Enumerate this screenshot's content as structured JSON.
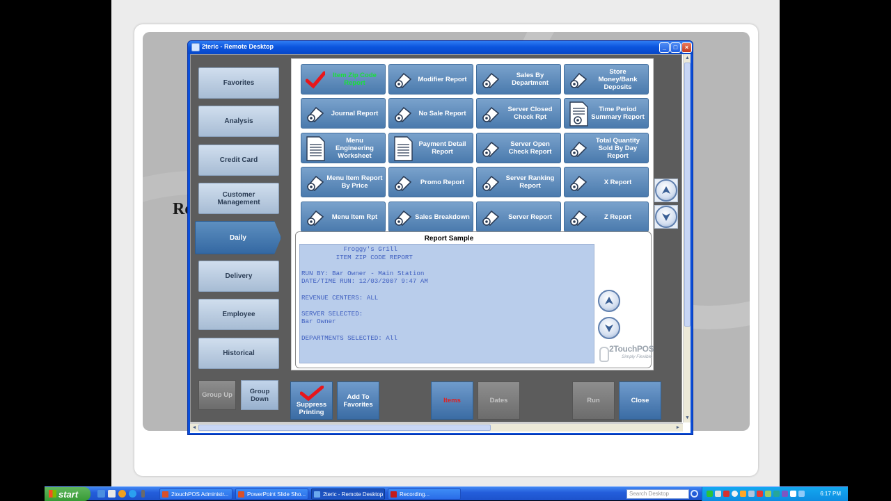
{
  "slide": {
    "background_word": "Re"
  },
  "window": {
    "title": "2teric - Remote Desktop",
    "min_label": "_",
    "max_label": "□",
    "close_label": "×"
  },
  "sidebar": {
    "items": [
      {
        "label": "Favorites"
      },
      {
        "label": "Analysis"
      },
      {
        "label": "Credit Card"
      },
      {
        "label": "Customer Management"
      },
      {
        "label": "Daily"
      },
      {
        "label": "Delivery"
      },
      {
        "label": "Employee"
      },
      {
        "label": "Historical"
      }
    ],
    "active": "Daily"
  },
  "reports": {
    "buttons": [
      {
        "label": "Item Zip Code Report",
        "icon": "red-check-icon",
        "selected": true
      },
      {
        "label": "Modifier Report",
        "icon": "paper-roll-icon"
      },
      {
        "label": "Sales By Department",
        "icon": "paper-roll-icon"
      },
      {
        "label": "Store Money/Bank Deposits",
        "icon": "paper-roll-icon"
      },
      {
        "label": "Journal Report",
        "icon": "paper-roll-icon"
      },
      {
        "label": "No Sale Report",
        "icon": "paper-roll-icon"
      },
      {
        "label": "Server Closed Check Rpt",
        "icon": "paper-roll-icon"
      },
      {
        "label": "Time Period Summary Report",
        "icon": "document-roll-icon"
      },
      {
        "label": "Menu Engineering Worksheet",
        "icon": "document-icon"
      },
      {
        "label": "Payment Detail Report",
        "icon": "document-icon"
      },
      {
        "label": "Server Open Check Report",
        "icon": "paper-roll-icon"
      },
      {
        "label": "Total Quantity Sold By Day Report",
        "icon": "paper-roll-icon"
      },
      {
        "label": "Menu Item Report By Price",
        "icon": "paper-roll-icon"
      },
      {
        "label": "Promo Report",
        "icon": "paper-roll-icon"
      },
      {
        "label": "Server Ranking Report",
        "icon": "paper-roll-icon"
      },
      {
        "label": "X Report",
        "icon": "paper-roll-icon"
      },
      {
        "label": "Menu Item Rpt",
        "icon": "paper-roll-icon"
      },
      {
        "label": "Sales Breakdown",
        "icon": "paper-roll-icon"
      },
      {
        "label": "Server Report",
        "icon": "paper-roll-icon"
      },
      {
        "label": "Z Report",
        "icon": "paper-roll-icon"
      }
    ]
  },
  "sample": {
    "title": "Report Sample",
    "text": "           Froggy's Grill\n         ITEM ZIP CODE REPORT\n\nRUN BY: Bar Owner - Main Station\nDATE/TIME RUN: 12/03/2007 9:47 AM\n\nREVENUE CENTERS: ALL\n\nSERVER SELECTED:\nBar Owner\n\nDEPARTMENTS SELECTED: All",
    "logo_name": "2TouchPOS",
    "logo_tag": "Simply Flexible"
  },
  "bottom": {
    "group_up": "Group Up",
    "group_down": "Group Down",
    "suppress_printing": "Suppress Printing",
    "add_to_favorites": "Add To Favorites",
    "items": "Items",
    "dates": "Dates",
    "run": "Run",
    "close": "Close"
  },
  "taskbar": {
    "start": "start",
    "tasks": [
      {
        "label": "2touchPOS Administr...",
        "color": "#d8502a"
      },
      {
        "label": "PowerPoint Slide Sho...",
        "color": "#d8502a"
      },
      {
        "label": "2teric - Remote Desktop",
        "color": "#6aa9ef",
        "active": true
      },
      {
        "label": "Recording...",
        "color": "#c41b1b"
      }
    ],
    "search_placeholder": "Search Desktop",
    "clock": "6:17 PM"
  },
  "colors": {
    "selected_label": "#19e03a",
    "items_label": "#e02020",
    "accent_blue": "#4a7aad"
  }
}
